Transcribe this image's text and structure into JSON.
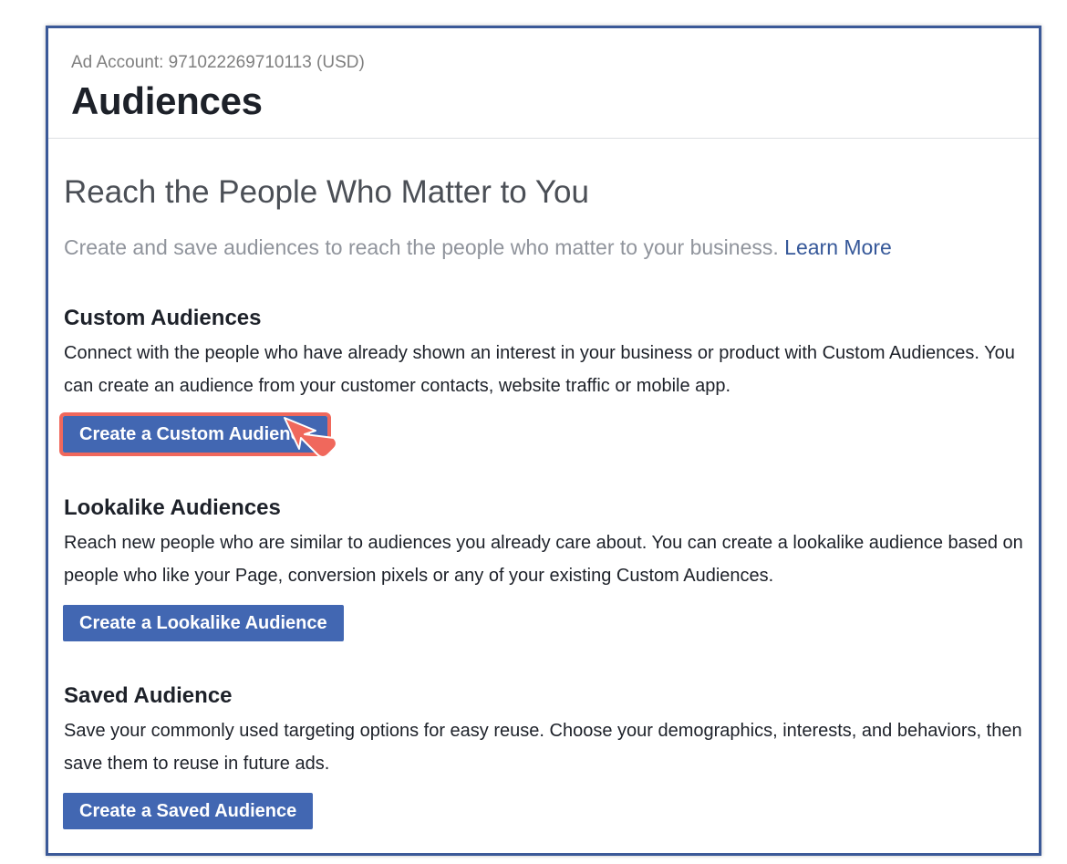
{
  "header": {
    "account_label": "Ad Account: 971022269710113 (USD)",
    "title": "Audiences"
  },
  "intro": {
    "headline": "Reach the People Who Matter to You",
    "subline": "Create and save audiences to reach the people who matter to your business.",
    "learn_more": "Learn More"
  },
  "sections": [
    {
      "title": "Custom Audiences",
      "description": "Connect with the people who have already shown an interest in your business or product with Custom Audiences. You can create an audience from your customer contacts, website traffic or mobile app.",
      "button": "Create a Custom Audience"
    },
    {
      "title": "Lookalike Audiences",
      "description": "Reach new people who are similar to audiences you already care about. You can create a lookalike audience based on people who like your Page, conversion pixels or any of your existing Custom Audiences.",
      "button": "Create a Lookalike Audience"
    },
    {
      "title": "Saved Audience",
      "description": "Save your commonly used targeting options for easy reuse. Choose your demographics, interests, and behaviors, then save them to reuse in future ads.",
      "button": "Create a Saved Audience"
    }
  ],
  "colors": {
    "frame_border": "#3b5998",
    "button_bg": "#4267b2",
    "link": "#365899",
    "highlight": "#f0685c"
  },
  "annotation": {
    "arrow_icon": "pointer-arrow-icon"
  }
}
